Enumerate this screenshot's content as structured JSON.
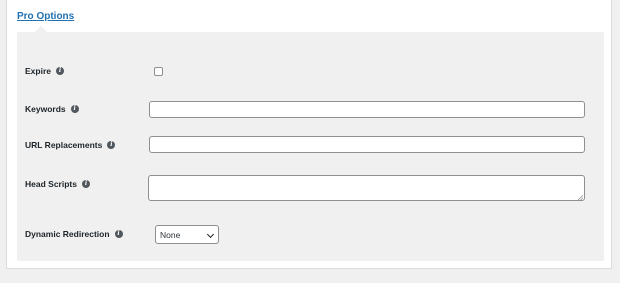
{
  "tab": {
    "label": "Pro Options"
  },
  "fields": {
    "expire": {
      "label": "Expire",
      "checked": false
    },
    "keywords": {
      "label": "Keywords",
      "value": ""
    },
    "url_replacements": {
      "label": "URL Replacements",
      "value": ""
    },
    "head_scripts": {
      "label": "Head Scripts",
      "value": ""
    },
    "dynamic_redirection": {
      "label": "Dynamic Redirection",
      "selected": "None"
    }
  },
  "icons": {
    "info": "info-icon"
  },
  "colors": {
    "link": "#2271b1",
    "area_bg": "#f0f0f1",
    "border": "#8c8f94"
  }
}
